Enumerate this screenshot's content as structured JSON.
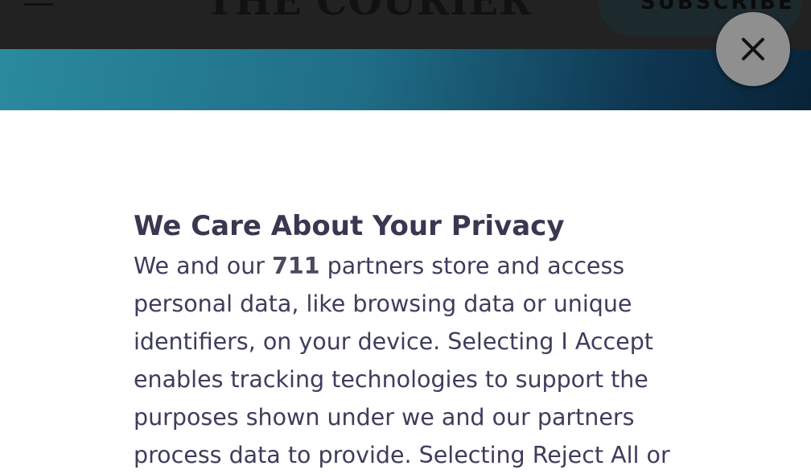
{
  "header": {
    "logo_text": "THE COURIER",
    "subscribe_label": "SUBSCRIBE",
    "menu_icon": "hamburger-menu-icon"
  },
  "overlay": {
    "close_icon": "close-icon"
  },
  "privacy": {
    "title": "We Care About Your Privacy",
    "body_before": "We and our ",
    "partner_count": "711",
    "body_after": " partners store and access personal data, like browsing data or unique identifiers, on your device. Selecting I Accept enables tracking technologies to support the purposes shown under we and our partners process data to provide. Selecting Reject All or"
  }
}
